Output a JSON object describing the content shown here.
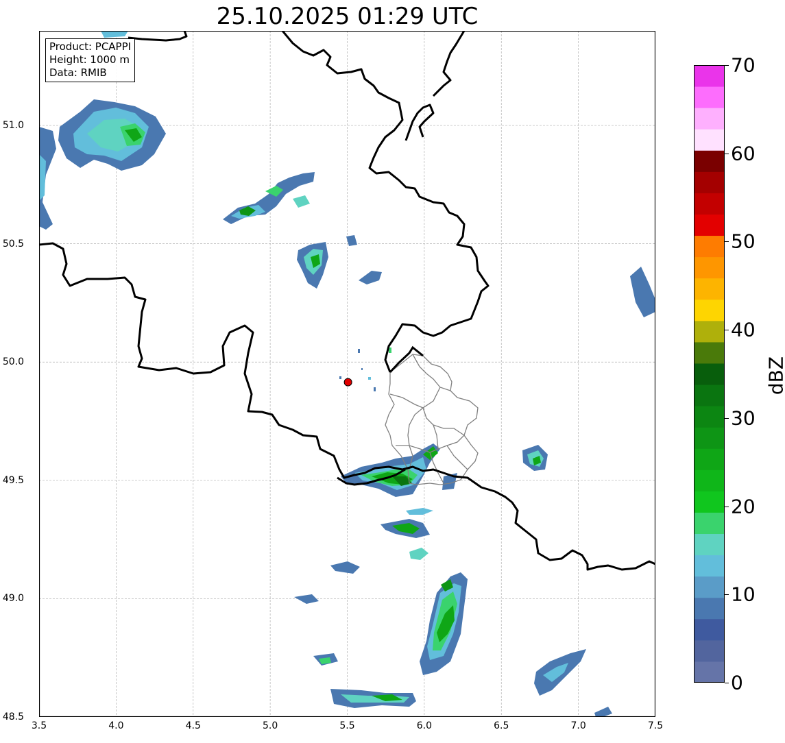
{
  "title": "25.10.2025 01:29 UTC",
  "info": {
    "product": "Product: PCAPPI",
    "height": "Height: 1000 m",
    "data": "Data: RMIB"
  },
  "map": {
    "lon_range": [
      3.5,
      7.5
    ],
    "lat_range": [
      48.5,
      51.4
    ],
    "x_ticks": [
      "3.5",
      "4.0",
      "4.5",
      "5.0",
      "5.5",
      "6.0",
      "6.5",
      "7.0",
      "7.5"
    ],
    "y_ticks": [
      "48.5",
      "49.0",
      "49.5",
      "50.0",
      "50.5",
      "51.0"
    ],
    "grid": "on",
    "radar_site": {
      "lon": 5.505,
      "lat": 49.915
    },
    "marker_color": "#e00000"
  },
  "colorbar": {
    "label": "dBZ",
    "range": [
      0,
      70
    ],
    "ticks": [
      "0",
      "10",
      "20",
      "30",
      "40",
      "50",
      "60",
      "70"
    ],
    "colors": [
      "#6574a8",
      "#52659e",
      "#3f5a9f",
      "#4a78b0",
      "#5a9cc8",
      "#62bedb",
      "#5fd3c1",
      "#3ad36d",
      "#10c61e",
      "#0fb619",
      "#0fa616",
      "#0e9515",
      "#0c8612",
      "#0a7510",
      "#085e0c",
      "#4a7a0a",
      "#afb00b",
      "#fed501",
      "#fdb400",
      "#fe9600",
      "#fe7c01",
      "#e30000",
      "#c30000",
      "#a40000",
      "#7a0000",
      "#ffe1ff",
      "#feb0fe",
      "#fd6dfd",
      "#ea34ea"
    ]
  }
}
